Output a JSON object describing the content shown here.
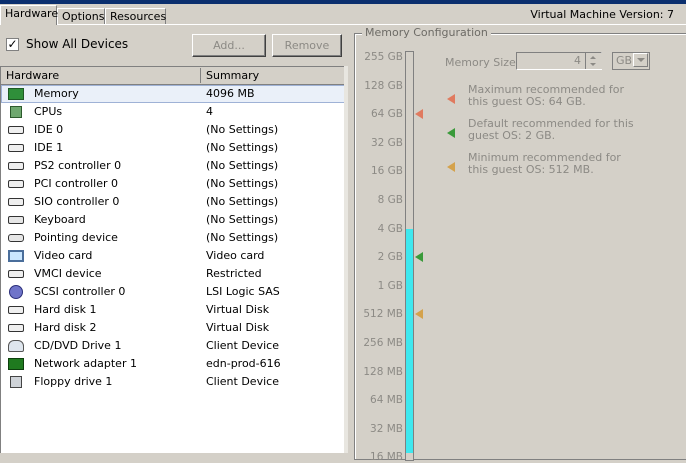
{
  "tabs": [
    {
      "label": "Hardware",
      "active": true
    },
    {
      "label": "Options",
      "active": false
    },
    {
      "label": "Resources",
      "active": false
    }
  ],
  "vm_version": "Virtual Machine Version: 7",
  "show_all_devices": {
    "label": "Show All Devices",
    "checked": true,
    "check_glyph": "✓"
  },
  "buttons": {
    "add": "Add...",
    "remove": "Remove"
  },
  "table": {
    "columns": [
      "Hardware",
      "Summary"
    ],
    "rows": [
      {
        "icon": "memory-icon",
        "name": "Memory",
        "summary": "4096 MB",
        "selected": true
      },
      {
        "icon": "cpu-icon",
        "name": "CPUs",
        "summary": "4"
      },
      {
        "icon": "ide-icon",
        "name": "IDE 0",
        "summary": "(No Settings)"
      },
      {
        "icon": "ide-icon",
        "name": "IDE 1",
        "summary": "(No Settings)"
      },
      {
        "icon": "controller-icon",
        "name": "PS2 controller 0",
        "summary": "(No Settings)"
      },
      {
        "icon": "controller-icon",
        "name": "PCI controller 0",
        "summary": "(No Settings)"
      },
      {
        "icon": "controller-icon",
        "name": "SIO controller 0",
        "summary": "(No Settings)"
      },
      {
        "icon": "keyboard-icon",
        "name": "Keyboard",
        "summary": "(No Settings)"
      },
      {
        "icon": "mouse-icon",
        "name": "Pointing device",
        "summary": "(No Settings)"
      },
      {
        "icon": "monitor-icon",
        "name": "Video card",
        "summary": "Video card"
      },
      {
        "icon": "vmci-icon",
        "name": "VMCI device",
        "summary": "Restricted"
      },
      {
        "icon": "scsi-icon",
        "name": "SCSI controller 0",
        "summary": "LSI Logic SAS"
      },
      {
        "icon": "disk-icon",
        "name": "Hard disk 1",
        "summary": "Virtual Disk"
      },
      {
        "icon": "disk-icon",
        "name": "Hard disk 2",
        "summary": "Virtual Disk"
      },
      {
        "icon": "cdrom-icon",
        "name": "CD/DVD Drive 1",
        "summary": "Client Device"
      },
      {
        "icon": "network-icon",
        "name": "Network adapter 1",
        "summary": "edn-prod-616"
      },
      {
        "icon": "floppy-icon",
        "name": "Floppy drive 1",
        "summary": "Client Device"
      }
    ]
  },
  "memory_config": {
    "title": "Memory Configuration",
    "scale_labels": [
      "255 GB",
      "128 GB",
      "64 GB",
      "32 GB",
      "16 GB",
      "8 GB",
      "4 GB",
      "2 GB",
      "1 GB",
      "512 MB",
      "256 MB",
      "128 MB",
      "64 MB",
      "32 MB",
      "16 MB"
    ],
    "current_level_label": "4 GB",
    "memory_size_label": "Memory Size:",
    "memory_size_value": "4",
    "unit": "GB",
    "notes": [
      {
        "text": "Maximum recommended for this guest OS: 64 GB.",
        "level_label": "64 GB",
        "color": "#e07a5f"
      },
      {
        "text": "Default recommended for this guest OS: 2 GB.",
        "level_label": "2 GB",
        "color": "#3a9a3a"
      },
      {
        "text": "Minimum recommended for this guest OS: 512 MB.",
        "level_label": "512 MB",
        "color": "#d4a24c"
      }
    ]
  },
  "colors": {
    "slider_fill": "#3ee8ef",
    "selected_row": "#eaf0f9"
  }
}
